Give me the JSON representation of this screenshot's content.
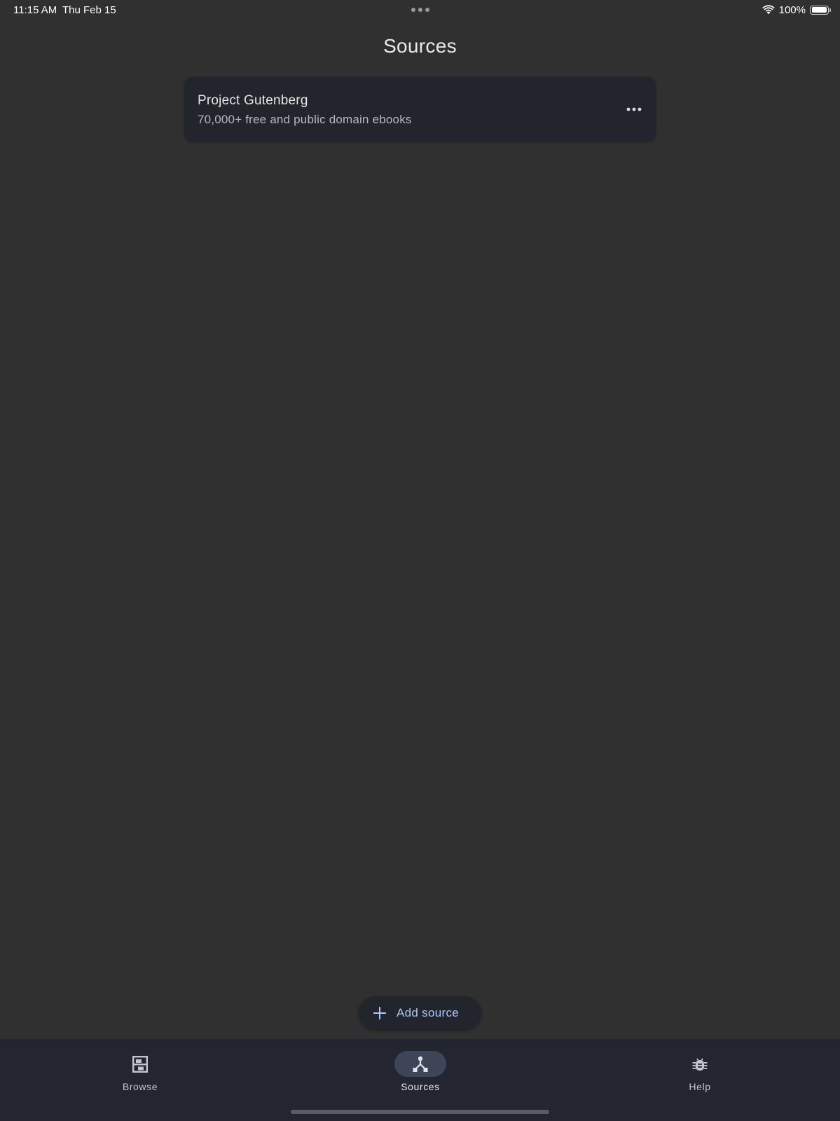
{
  "status_bar": {
    "time": "11:15 AM",
    "date": "Thu Feb 15",
    "battery_percent_label": "100%",
    "battery_level": 1.0
  },
  "page": {
    "title": "Sources"
  },
  "sources": [
    {
      "name": "Project Gutenberg",
      "description": "70,000+ free and public domain ebooks"
    }
  ],
  "fab": {
    "label": "Add source",
    "icon": "plus-icon",
    "text_color": "#aec6f5"
  },
  "bottom_nav": {
    "items": [
      {
        "label": "Browse",
        "icon": "bookshelf-icon",
        "active": false
      },
      {
        "label": "Sources",
        "icon": "source-branch-icon",
        "active": true
      },
      {
        "label": "Help",
        "icon": "bug-icon",
        "active": false
      }
    ]
  },
  "colors": {
    "background": "#303030",
    "card": "#22252b",
    "nav_background": "#232630",
    "active_indicator": "#3d4556"
  }
}
